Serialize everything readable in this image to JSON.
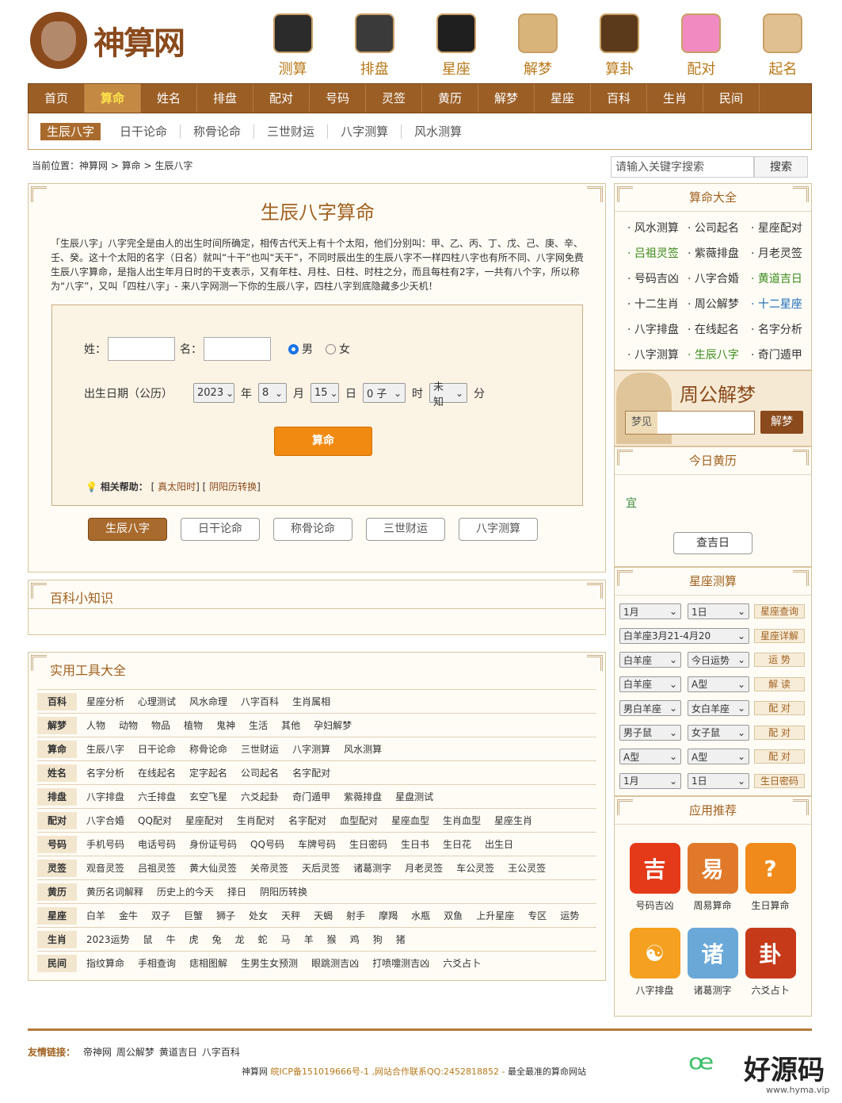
{
  "logo": {
    "text": "神算网"
  },
  "topnav": [
    {
      "label": "测算",
      "icon": "yin-yang",
      "color": "#2b2b2b"
    },
    {
      "label": "排盘",
      "icon": "bagua",
      "color": "#3a3a3a"
    },
    {
      "label": "星座",
      "icon": "compass",
      "color": "#1f1f1f"
    },
    {
      "label": "解梦",
      "icon": "book",
      "color": "#d8b47a"
    },
    {
      "label": "算卦",
      "icon": "gua",
      "color": "#5a3a1a"
    },
    {
      "label": "配对",
      "icon": "heart",
      "color": "#f08ac0"
    },
    {
      "label": "起名",
      "icon": "name",
      "color": "#e0c090"
    }
  ],
  "mainnav": [
    "首页",
    "算命",
    "姓名",
    "排盘",
    "配对",
    "号码",
    "灵签",
    "黄历",
    "解梦",
    "星座",
    "百科",
    "生肖",
    "民间"
  ],
  "subnav": [
    "生辰八字",
    "日干论命",
    "称骨论命",
    "三世财运",
    "八字测算",
    "风水测算"
  ],
  "crumb": "当前位置：神算网 > 算命 > 生辰八字",
  "search": {
    "placeholder": "请输入关键字搜索",
    "button": "搜索"
  },
  "main": {
    "title": "生辰八字算命",
    "intro": "「生辰八字」八字完全是由人的出生时间所确定，相传古代天上有十个太阳，他们分别叫：甲、乙、丙、丁、戊、己、庚、辛、壬、癸。这十个太阳的名字（日名）就叫“十干”也叫“天干”，不同时辰出生的生辰八字不一样四柱八字也有所不同、八字网免费生辰八字算命，是指人出生年月日时的干支表示，又有年柱、月柱、日柱、时柱之分，而且每柱有2字，一共有八个字，所以称为“八字”，又叫「四柱八字」- 来八字网测一下你的生辰八字，四柱八字到底隐藏多少天机！"
  },
  "form": {
    "surname": "姓：",
    "name": "名：",
    "male": "男",
    "female": "女",
    "birth": "出生日期（公历）",
    "year": "2023",
    "year_u": "年",
    "month": "8",
    "month_u": "月",
    "day": "15",
    "day_u": "日",
    "hour": "0 子",
    "hour_u": "时",
    "minute": "未知",
    "minute_u": "分",
    "submit": "算命",
    "help_label": "相关帮助：",
    "help1": "真太阳时",
    "help2": "阴阳历转换"
  },
  "tabs": [
    "生辰八字",
    "日干论命",
    "称骨论命",
    "三世财运",
    "八字测算"
  ],
  "baike": {
    "title": "百科小知识"
  },
  "tools": {
    "title": "实用工具大全",
    "rows": [
      {
        "label": "百科",
        "items": [
          "星座分析",
          "心理测试",
          "风水命理",
          "八字百科",
          "生肖属相"
        ]
      },
      {
        "label": "解梦",
        "items": [
          "人物",
          "动物",
          "物品",
          "植物",
          "鬼神",
          "生活",
          "其他",
          "孕妇解梦"
        ]
      },
      {
        "label": "算命",
        "items": [
          "生辰八字",
          "日干论命",
          "称骨论命",
          "三世财运",
          "八字测算",
          "风水测算"
        ]
      },
      {
        "label": "姓名",
        "items": [
          "名字分析",
          "在线起名",
          "定字起名",
          "公司起名",
          "名字配对"
        ]
      },
      {
        "label": "排盘",
        "items": [
          "八字排盘",
          "六壬排盘",
          "玄空飞星",
          "六爻起卦",
          "奇门遁甲",
          "紫薇排盘",
          "星盘测试"
        ]
      },
      {
        "label": "配对",
        "items": [
          "八字合婚",
          "QQ配对",
          "星座配对",
          "生肖配对",
          "名字配对",
          "血型配对",
          "星座血型",
          "生肖血型",
          "星座生肖"
        ]
      },
      {
        "label": "号码",
        "items": [
          "手机号码",
          "电话号码",
          "身份证号码",
          "QQ号码",
          "车牌号码",
          "生日密码",
          "生日书",
          "生日花",
          "出生日"
        ]
      },
      {
        "label": "灵签",
        "items": [
          "观音灵签",
          "吕祖灵签",
          "黄大仙灵签",
          "关帝灵签",
          "天后灵签",
          "诸葛测字",
          "月老灵签",
          "车公灵签",
          "王公灵签"
        ]
      },
      {
        "label": "黄历",
        "items": [
          "黄历名词解释",
          "历史上的今天",
          "择日",
          "阴阳历转换"
        ]
      },
      {
        "label": "星座",
        "items": [
          "白羊",
          "金牛",
          "双子",
          "巨蟹",
          "狮子",
          "处女",
          "天秤",
          "天蝎",
          "射手",
          "摩羯",
          "水瓶",
          "双鱼",
          "上升星座",
          "专区",
          "运势"
        ]
      },
      {
        "label": "生肖",
        "items": [
          "2023运势",
          "鼠",
          "牛",
          "虎",
          "兔",
          "龙",
          "蛇",
          "马",
          "羊",
          "猴",
          "鸡",
          "狗",
          "猪"
        ]
      },
      {
        "label": "民间",
        "items": [
          "指纹算命",
          "手相查询",
          "痣相图解",
          "生男生女预测",
          "眼跳测吉凶",
          "打喷嚏测吉凶",
          "六爻占卜"
        ]
      }
    ]
  },
  "side": {
    "suanming": {
      "title": "算命大全",
      "links": [
        "风水测算",
        "公司起名",
        "星座配对",
        "吕祖灵签",
        "紫薇排盘",
        "月老灵签",
        "号码吉凶",
        "八字合婚",
        "黄道吉日",
        "十二生肖",
        "周公解梦",
        "十二星座",
        "八字排盘",
        "在线起名",
        "名字分析",
        "八字测算",
        "生辰八字",
        "奇门遁甲"
      ]
    },
    "dream": {
      "title": "周公解梦",
      "label": "梦见",
      "button": "解梦"
    },
    "huangli": {
      "title": "今日黄历",
      "glyph": "宜",
      "button": "查吉日"
    },
    "xingzuo": {
      "title": "星座测算",
      "rows": [
        [
          "1月",
          "1日",
          "星座查询"
        ],
        [
          "白羊座3月21-4月20",
          "",
          "星座详解"
        ],
        [
          "白羊座",
          "今日运势",
          "运 势"
        ],
        [
          "白羊座",
          "A型",
          "解 读"
        ],
        [
          "男白羊座",
          "女白羊座",
          "配 对"
        ],
        [
          "男子鼠",
          "女子鼠",
          "配 对"
        ],
        [
          "A型",
          "A型",
          "配 对"
        ],
        [
          "1月",
          "1日",
          "生日密码"
        ]
      ]
    },
    "apps": {
      "title": "应用推荐",
      "items": [
        {
          "label": "号码吉凶",
          "glyph": "吉",
          "color": "#e43a1a"
        },
        {
          "label": "周易算命",
          "glyph": "易",
          "color": "#e07a2a"
        },
        {
          "label": "生日算命",
          "glyph": "?",
          "color": "#f08a1a"
        },
        {
          "label": "八字排盘",
          "glyph": "☯",
          "color": "#f5a020"
        },
        {
          "label": "诸葛测字",
          "glyph": "诸",
          "color": "#6aa8d8"
        },
        {
          "label": "六爻占卜",
          "glyph": "卦",
          "color": "#c63a1a"
        }
      ]
    }
  },
  "footer": {
    "label": "友情链接：",
    "links": [
      "帝神网",
      "周公解梦",
      "黄道吉日",
      "八字百科"
    ],
    "site": "神算网",
    "icp": "皖ICP备151019666号-1 ,网站合作联系QQ:2452818852 -",
    "tail": "最全最准的算命网站"
  },
  "watermark": {
    "text": "好源码",
    "url": "www.hyma.vip"
  }
}
